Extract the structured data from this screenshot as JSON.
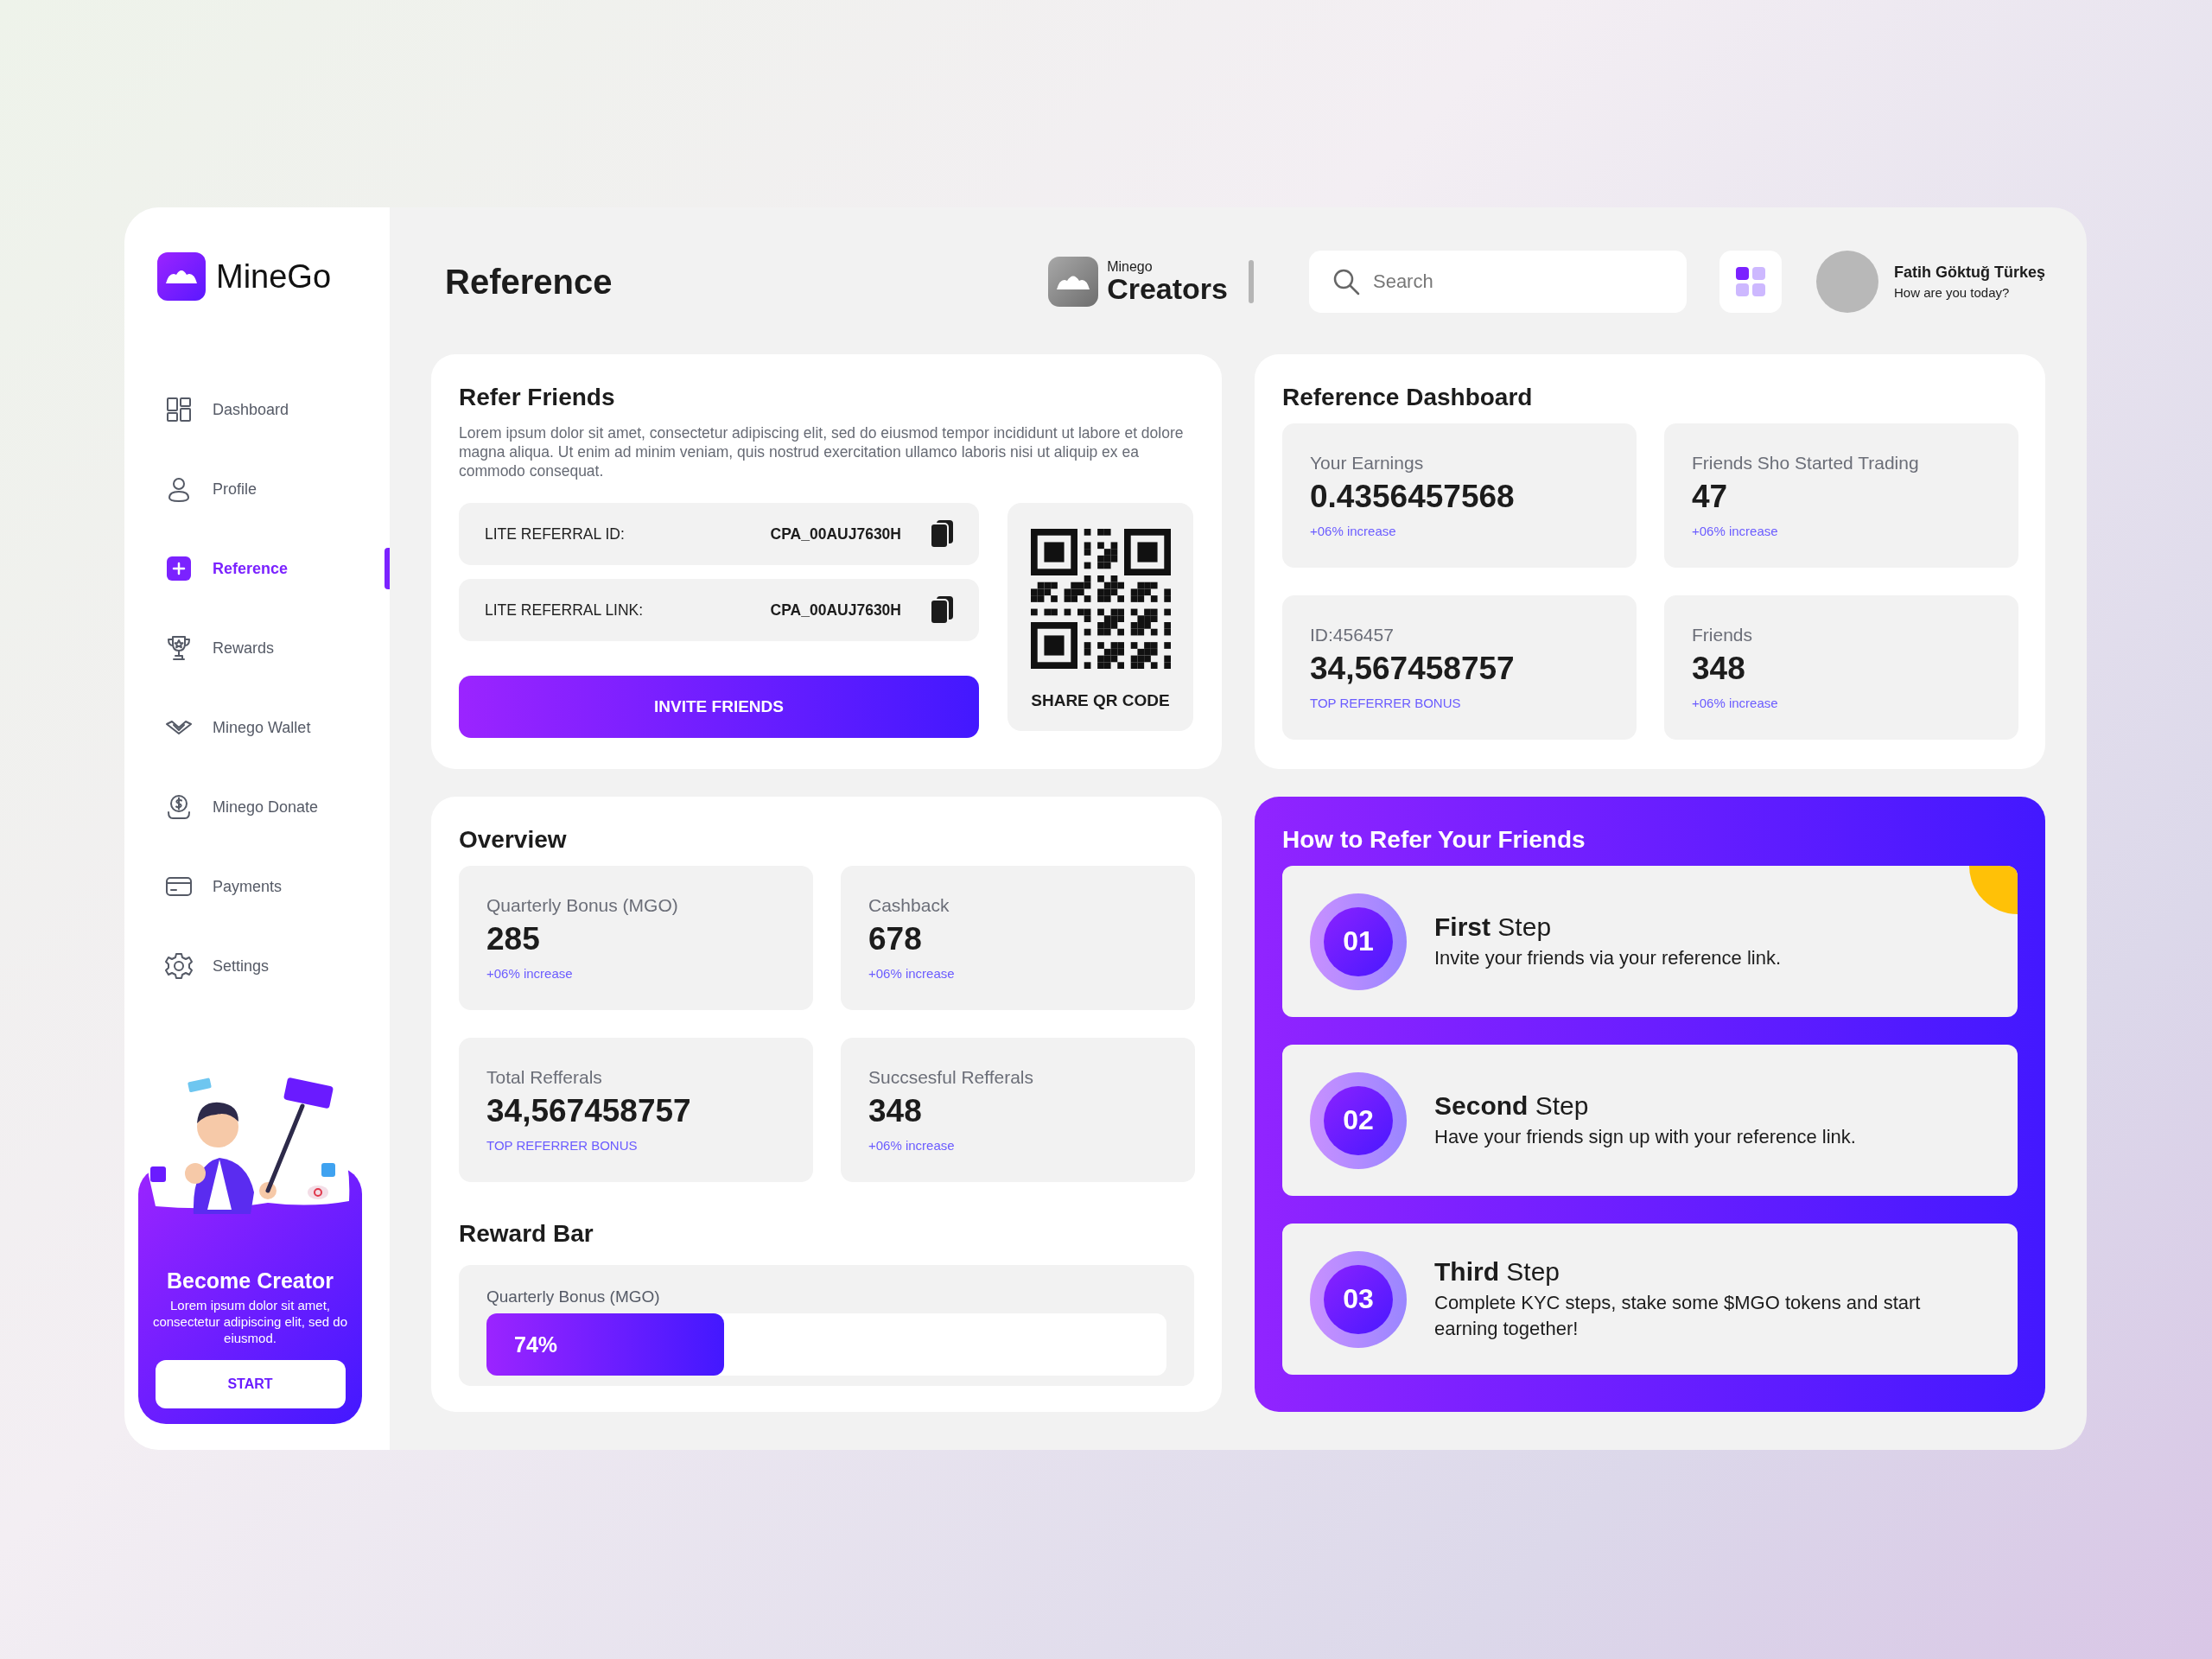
{
  "sidebar": {
    "logo": "MineGo",
    "items": [
      {
        "label": "Dashboard",
        "selected": false
      },
      {
        "label": "Profile",
        "selected": false
      },
      {
        "label": "Reference",
        "selected": true
      },
      {
        "label": "Rewards",
        "selected": false
      },
      {
        "label": "Minego Wallet",
        "selected": false
      },
      {
        "label": "Minego Donate",
        "selected": false
      },
      {
        "label": "Payments",
        "selected": false
      },
      {
        "label": "Settings",
        "selected": false
      }
    ],
    "promo": {
      "title": "Become Creator",
      "text": "Lorem ipsum dolor sit amet, consectetur adipiscing elit, sed do eiusmod.",
      "button": "START"
    }
  },
  "header": {
    "title": "Reference",
    "brand": {
      "small": "Minego",
      "name": "Creators"
    },
    "search": {
      "placeholder": "Search"
    },
    "user": {
      "name": "Fatih Göktuğ Türkeş",
      "greeting": "How are you today?"
    }
  },
  "refer_friends": {
    "title": "Refer Friends",
    "description": "Lorem ipsum dolor sit amet, consectetur adipiscing elit, sed do eiusmod tempor incididunt ut labore et dolore magna aliqua. Ut enim ad minim veniam, quis nostrud exercitation ullamco laboris nisi ut aliquip ex ea commodo consequat.",
    "fields": [
      {
        "label": "LITE REFERRAL ID:",
        "value": "CPA_00AUJ7630H"
      },
      {
        "label": "LITE REFERRAL LINK:",
        "value": "CPA_00AUJ7630H"
      }
    ],
    "invite_button": "INVITE FRIENDS",
    "qr_label": "SHARE QR CODE"
  },
  "reference_dashboard": {
    "title": "Reference Dashboard",
    "stats": [
      {
        "label": "Your Earnings",
        "value": "0.4356457568",
        "note": "+06% increase"
      },
      {
        "label": "Friends Sho Started Trading",
        "value": "47",
        "note": "+06% increase"
      },
      {
        "label": "ID:456457",
        "value": "34,567458757",
        "note": "TOP REFERRER BONUS"
      },
      {
        "label": "Friends",
        "value": "348",
        "note": "+06% increase"
      }
    ]
  },
  "overview": {
    "title": "Overview",
    "stats": [
      {
        "label": "Quarterly Bonus (MGO)",
        "value": "285",
        "note": "+06% increase"
      },
      {
        "label": "Cashback",
        "value": "678",
        "note": "+06% increase"
      },
      {
        "label": "Total Refferals",
        "value": "34,567458757",
        "note": "TOP REFERRER BONUS"
      },
      {
        "label": "Succsesful Refferals",
        "value": "348",
        "note": "+06% increase"
      }
    ]
  },
  "reward_bar": {
    "title": "Reward Bar",
    "label": "Quarterly Bonus (MGO)",
    "level": 0.35,
    "reading": "74%"
  },
  "how_to": {
    "title": "How to Refer Your Friends",
    "steps": [
      {
        "number": "01",
        "title": "**First** Step",
        "text": "Invite your friends via your reference link."
      },
      {
        "number": "02",
        "title": "**Second** Step",
        "text": "Have your friends sign up with your reference link."
      },
      {
        "number": "03",
        "title": "**Third** Step",
        "text": "Complete KYC steps, stake some $MGO tokens and start earning together!"
      }
    ]
  }
}
